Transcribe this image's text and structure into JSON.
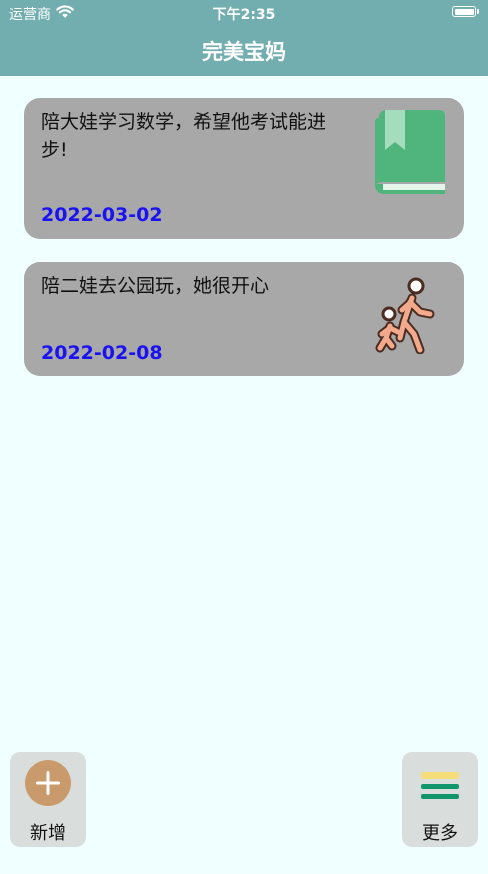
{
  "status_bar": {
    "carrier": "运营商",
    "time": "下午2:35"
  },
  "nav": {
    "title": "完美宝妈"
  },
  "records": [
    {
      "text": "陪大娃学习数学，希望他考试能进步!",
      "date": "2022-03-02",
      "icon": "book-icon"
    },
    {
      "text": "陪二娃去公园玩，她很开心",
      "date": "2022-02-08",
      "icon": "parent-child-walking-icon"
    }
  ],
  "bottom_bar": {
    "add_label": "新增",
    "more_label": "更多"
  },
  "colors": {
    "header": "#72aeaf",
    "background": "#f0ffff",
    "card": "#a8a8a8",
    "date": "#1a12f0",
    "add_icon": "#c99a6b"
  }
}
